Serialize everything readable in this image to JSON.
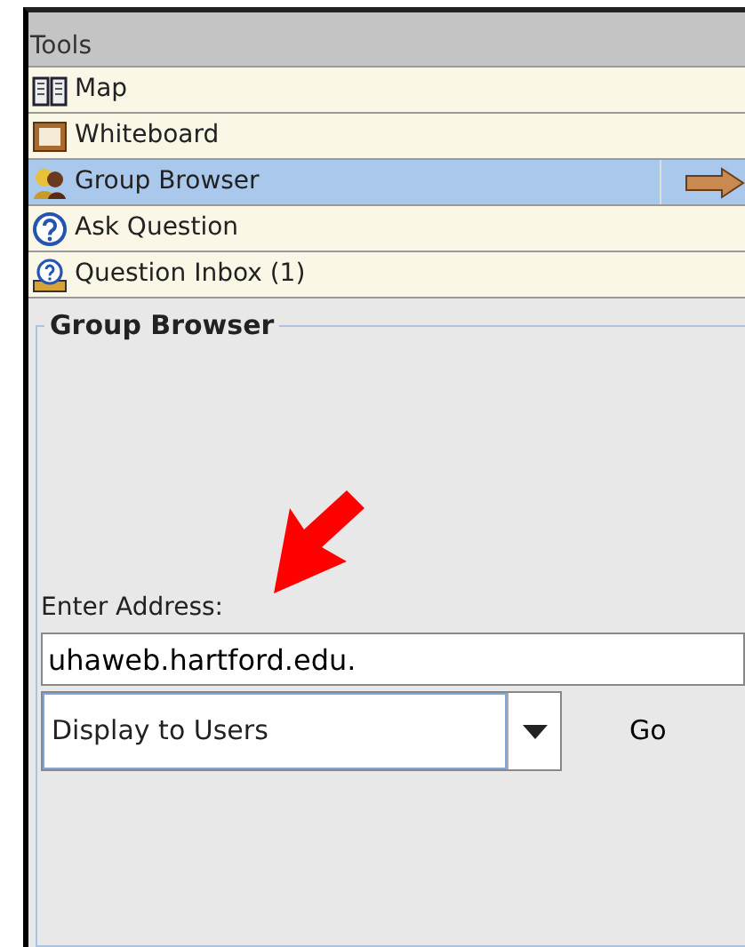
{
  "tools": {
    "header": "Tools",
    "items": [
      {
        "label": "Map",
        "selected": false
      },
      {
        "label": "Whiteboard",
        "selected": false
      },
      {
        "label": "Group Browser",
        "selected": true
      },
      {
        "label": "Ask Question",
        "selected": false
      },
      {
        "label": "Question Inbox (1)",
        "selected": false
      }
    ]
  },
  "panel": {
    "title": "Group Browser",
    "address_label": "Enter Address:",
    "address_value": "uhaweb.hartford.edu.",
    "display_select": "Display to Users",
    "go_button": "Go"
  }
}
